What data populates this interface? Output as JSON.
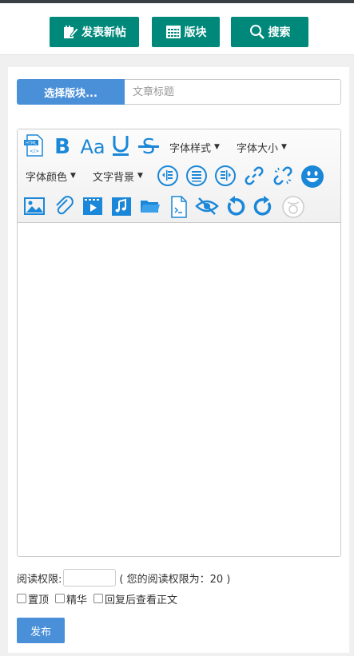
{
  "header": {
    "new_post_label": "发表新帖",
    "forums_label": "版块",
    "search_label": "搜索",
    "accent_color": "#00897b"
  },
  "composer": {
    "forum_select_label": "选择版块...",
    "title_placeholder": "文章标题",
    "accent_color": "#4a90d9"
  },
  "toolbar": {
    "font_style_label": "字体样式",
    "font_size_label": "字体大小",
    "font_color_label": "字体颜色",
    "text_bg_label": "文字背景",
    "icon_color": "#1a87d8",
    "icons": [
      "html-source-icon",
      "bold-icon",
      "font-icon",
      "underline-icon",
      "strikethrough-icon",
      "align-left-icon",
      "align-center-icon",
      "align-right-icon",
      "link-icon",
      "unlink-icon",
      "emoji-icon",
      "image-icon",
      "attachment-icon",
      "video-icon",
      "music-icon",
      "folder-icon",
      "code-icon",
      "hide-content-icon",
      "undo-icon",
      "redo-icon",
      "disabled-badge-icon"
    ]
  },
  "permissions": {
    "label": "阅读权限:",
    "note": "( 您的阅读权限为：20 )"
  },
  "options": {
    "sticky_label": "置顶",
    "featured_label": "精华",
    "reply_to_view_label": "回复后查看正文"
  },
  "submit_label": "发布"
}
